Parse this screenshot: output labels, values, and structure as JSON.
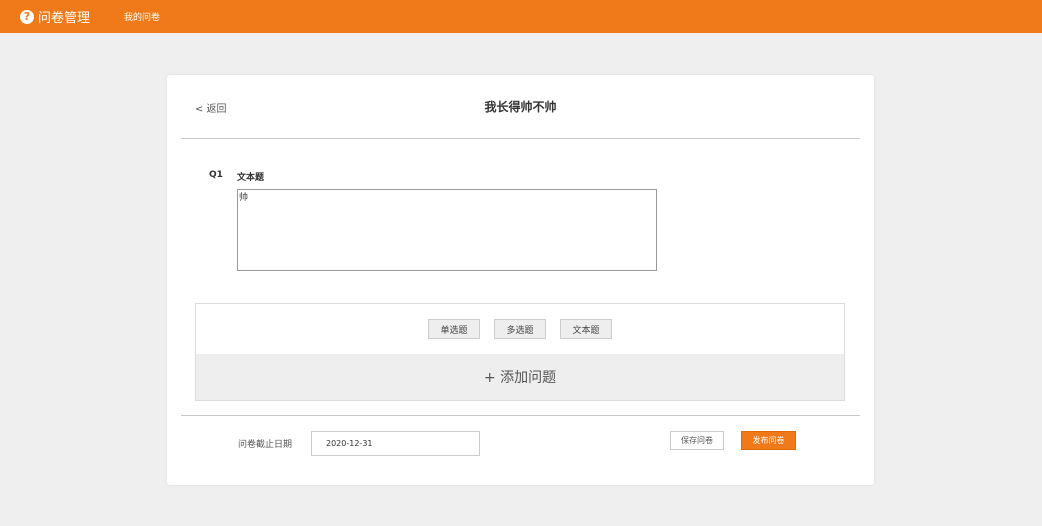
{
  "header": {
    "brand_icon": "?",
    "brand_title": "问卷管理",
    "nav_my_surveys": "我的问卷",
    "accent_color": "#f07a1a"
  },
  "survey": {
    "back_label": "< 返回",
    "title": "我长得帅不帅",
    "questions": [
      {
        "number": "Q1",
        "title": "文本题",
        "answer": "帅"
      }
    ]
  },
  "add_question": {
    "types": [
      "单选题",
      "多选题",
      "文本题"
    ],
    "add_label": "+ 添加问题"
  },
  "footer": {
    "deadline_label": "问卷截止日期",
    "deadline_value": "2020-12-31",
    "save_label": "保存问卷",
    "publish_label": "发布问卷"
  }
}
